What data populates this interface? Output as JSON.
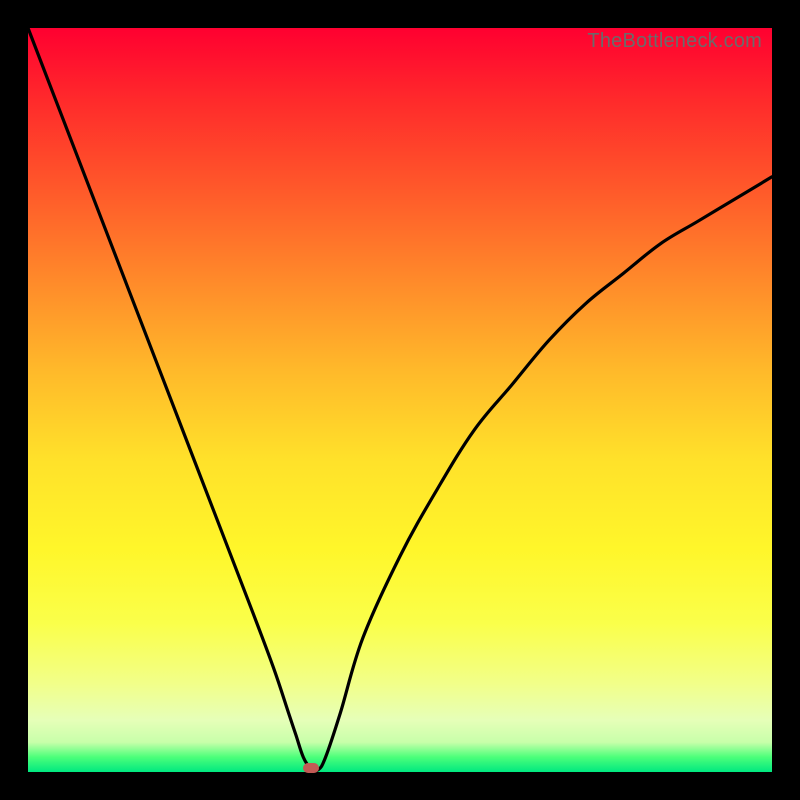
{
  "attribution": "TheBottleneck.com",
  "colors": {
    "frame": "#000000",
    "gradient_top": "#ff0030",
    "gradient_bottom": "#00e880",
    "curve": "#000000",
    "marker": "#c15a55",
    "attribution_text": "#6b6b6b"
  },
  "chart_data": {
    "type": "line",
    "title": "",
    "xlabel": "",
    "ylabel": "",
    "xlim": [
      0,
      100
    ],
    "ylim": [
      0,
      100
    ],
    "grid": false,
    "annotations": [
      {
        "text": "TheBottleneck.com",
        "position": "top-right"
      }
    ],
    "series": [
      {
        "name": "curve",
        "x": [
          0,
          5,
          10,
          15,
          20,
          25,
          30,
          33,
          35,
          36,
          37,
          38,
          39,
          40,
          42,
          45,
          50,
          55,
          60,
          65,
          70,
          75,
          80,
          85,
          90,
          95,
          100
        ],
        "values": [
          100,
          87,
          74,
          61,
          48,
          35,
          22,
          14,
          8,
          5,
          2,
          0.5,
          0.3,
          2,
          8,
          18,
          29,
          38,
          46,
          52,
          58,
          63,
          67,
          71,
          74,
          77,
          80
        ]
      }
    ],
    "marker": {
      "x": 38,
      "y": 0.5
    }
  }
}
